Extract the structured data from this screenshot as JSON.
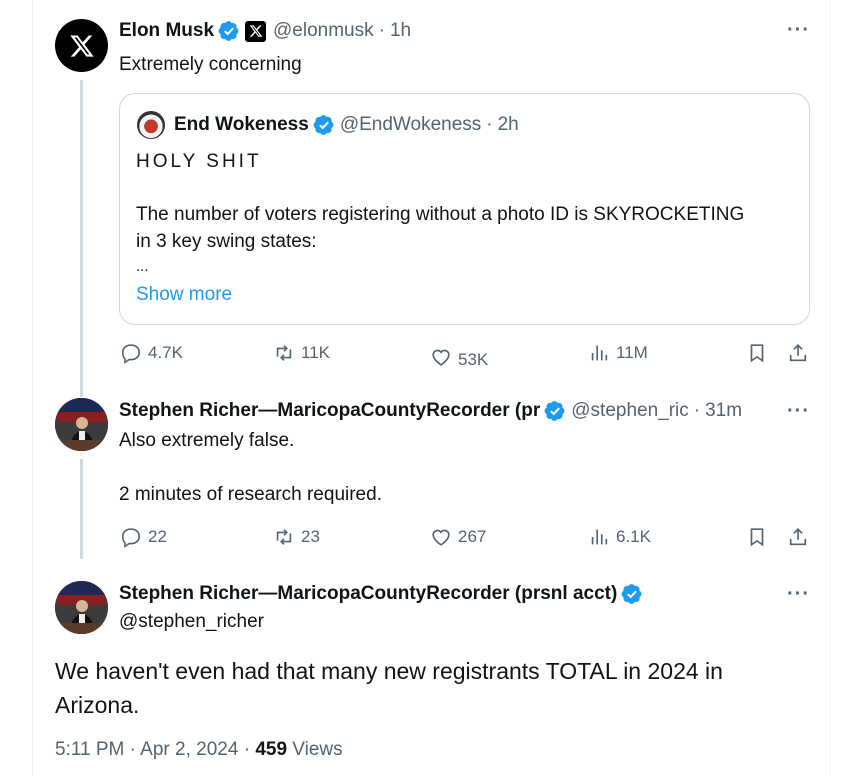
{
  "tweets": [
    {
      "name": "Elon Musk",
      "handle": "@elonmusk",
      "time": "1h",
      "text": "Extremely concerning",
      "quote": {
        "name": "End Wokeness",
        "handle": "@EndWokeness",
        "time": "2h",
        "line1": "HOLY SHIT",
        "line2": "The number of voters registering without a photo ID is SKYROCKETING",
        "line3": "in 3 key swing states:",
        "line4": "...",
        "show_more": "Show more"
      },
      "stats": {
        "replies": "4.7K",
        "reposts": "11K",
        "likes": "53K",
        "views": "11M"
      }
    },
    {
      "name": "Stephen Richer—MaricopaCountyRecorder (pr",
      "handle": "@stephen_ric",
      "time": "31m",
      "line1": "Also extremely false.",
      "line2": "2 minutes of research required.",
      "stats": {
        "replies": "22",
        "reposts": "23",
        "likes": "267",
        "views": "6.1K"
      }
    }
  ],
  "main_tweet": {
    "name": "Stephen Richer—MaricopaCountyRecorder (prsnl acct)",
    "handle": "@stephen_richer",
    "line1": "We haven't even had that many new registrants TOTAL in 2024 in",
    "line2": "Arizona.",
    "timestamp": "5:11 PM · Apr 2, 2024 ·",
    "views_count": "459",
    "views_label": "Views"
  },
  "separators": {
    "dot": "·"
  },
  "colors": {
    "accent": "#1d9bf0",
    "secondary": "#536471",
    "border": "#cfd9de"
  }
}
